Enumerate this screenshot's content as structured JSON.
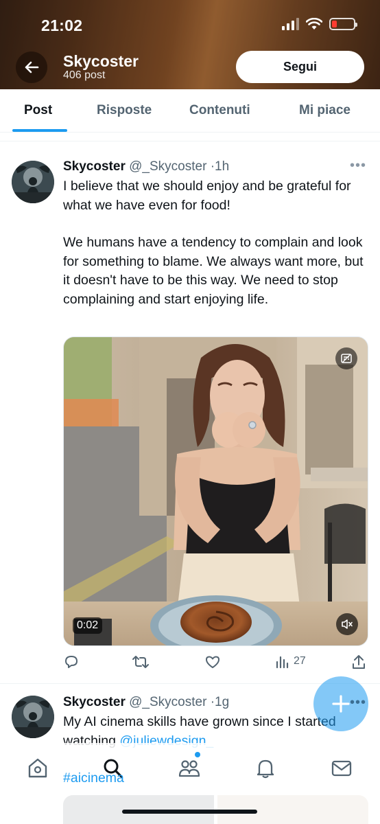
{
  "status_bar": {
    "time": "21:02"
  },
  "header": {
    "profile_name": "Skycoster",
    "post_count": "406 post",
    "follow_label": "Segui"
  },
  "tabs": [
    {
      "label": "Post",
      "active": true
    },
    {
      "label": "Risposte",
      "active": false
    },
    {
      "label": "Contenuti",
      "active": false
    },
    {
      "label": "Mi piace",
      "active": false
    }
  ],
  "posts": [
    {
      "display_name": "Skycoster",
      "handle": "@_Skycoster",
      "separator": "·",
      "time": "1h",
      "paragraphs": [
        "I believe that we should enjoy and be grateful for what we have even for food!",
        "We humans have a tendency to complain and look for something to blame. We always want more, but it doesn't have to be this way. We need to stop complaining and start enjoying life."
      ],
      "video": {
        "duration": "0:02"
      },
      "stats": {
        "views": "27"
      }
    },
    {
      "display_name": "Skycoster",
      "handle": "@_Skycoster",
      "separator": "·",
      "time": "1g",
      "text": "My AI cinema skills have grown since I started watching ",
      "mention": "@juliewdesign_",
      "hashtag": "#aicinema"
    }
  ],
  "fab": {
    "icon": "compose-plus-icon"
  },
  "bottom_nav": [
    "home-icon",
    "search-icon",
    "communities-icon",
    "notifications-icon",
    "messages-icon"
  ],
  "colors": {
    "accent": "#1d9bf0",
    "text": "#0f1419",
    "muted": "#536471",
    "battery_low": "#ff3b30"
  }
}
